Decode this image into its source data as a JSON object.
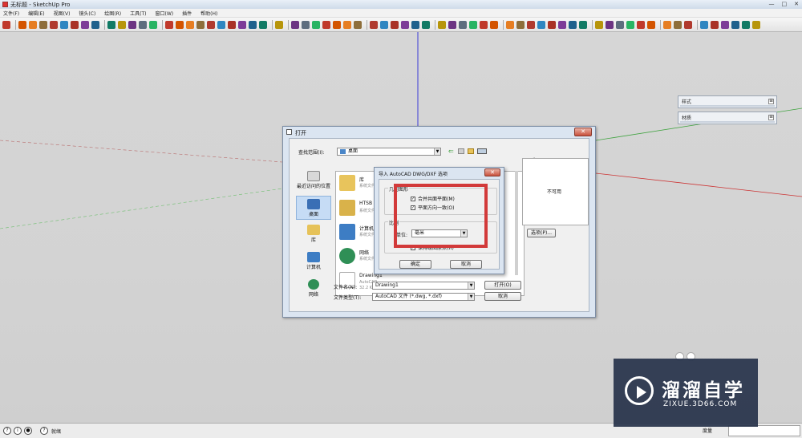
{
  "window": {
    "title": "无标题 - SketchUp Pro",
    "controls": [
      "—",
      "□",
      "✕"
    ]
  },
  "menu": [
    "文件(F)",
    "编辑(E)",
    "视图(V)",
    "镜头(C)",
    "绘图(R)",
    "工具(T)",
    "窗口(W)",
    "插件",
    "帮助(H)"
  ],
  "toolbar_icons": [
    "select",
    "pencil",
    "rectangle",
    "circle",
    "arc",
    "polygon",
    "eraser",
    "paint-bucket",
    "push-pull",
    "move",
    "rotate",
    "scale",
    "offset",
    "follow-me",
    "orbit",
    "pan",
    "zoom",
    "zoom-window",
    "zoom-extents",
    "previous-view",
    "next-view",
    "camera",
    "walk",
    "look-around",
    "section-plane",
    "iso",
    "top",
    "front",
    "right",
    "back",
    "left",
    "bottom",
    "xray",
    "wireframe",
    "hidden-line",
    "shaded",
    "textured",
    "monochrome",
    "tape",
    "dimension",
    "protractor",
    "text",
    "axes",
    "3d-text",
    "sandbox",
    "smoove",
    "stamp",
    "drape",
    "add-detail",
    "flip-edge",
    "components",
    "layers",
    "materials",
    "styles",
    "shadows",
    "fog",
    "match-photo",
    "warehouse",
    "share",
    "extension",
    "solid",
    "outer-shell",
    "intersect",
    "union",
    "subtract",
    "trim",
    "split"
  ],
  "trays": [
    {
      "label": "样式",
      "btn": "⊞"
    },
    {
      "label": "材质",
      "btn": "⊞"
    }
  ],
  "open_dialog": {
    "title": "打开",
    "close": "✕",
    "lookin_label": "查找范围(I):",
    "lookin_value": "桌面",
    "places": [
      {
        "label": "最近访问的位置"
      },
      {
        "label": "桌面"
      },
      {
        "label": "库"
      },
      {
        "label": "计算机"
      },
      {
        "label": "网络"
      }
    ],
    "files": [
      {
        "name": "库",
        "sub": "系统文件夹"
      },
      {
        "name": "HTSB",
        "sub": "系统文件夹"
      },
      {
        "name": "计算机",
        "sub": "系统文件夹"
      },
      {
        "name": "网络",
        "sub": "系统文件夹"
      },
      {
        "name": "Drawing1",
        "sub": "AutoCAD",
        "size": "32.2 KB"
      }
    ],
    "preview_label": "预览",
    "preview_text": "不可用",
    "options_button": "选项(P)...",
    "filename_label": "文件名(N):",
    "filename_value": "Drawing1",
    "filetype_label": "文件类型(T):",
    "filetype_value": "AutoCAD 文件 (*.dwg, *.dxf)",
    "open_button": "打开(O)",
    "cancel_button": "取消"
  },
  "import_dialog": {
    "title": "导入 AutoCAD DWG/DXF 选项",
    "close": "✕",
    "geometry_label": "几何图形",
    "merge_label": "合并共面平面(M)",
    "merge_checked": true,
    "orient_label": "平面方向一致(O)",
    "orient_checked": true,
    "scale_label": "比例",
    "units_label": "单位:",
    "units_value": "毫米",
    "keep_origin_label": "保持绘图原点(R)",
    "keep_origin_checked": true,
    "ok_button": "确定",
    "cancel_button": "取消"
  },
  "status": {
    "text": "就绪",
    "measure_label": "度量",
    "icons": [
      "?",
      "i",
      "●",
      "?"
    ]
  },
  "watermark": {
    "cn": "溜溜自学",
    "en": "ZIXUE.3D66.COM"
  }
}
